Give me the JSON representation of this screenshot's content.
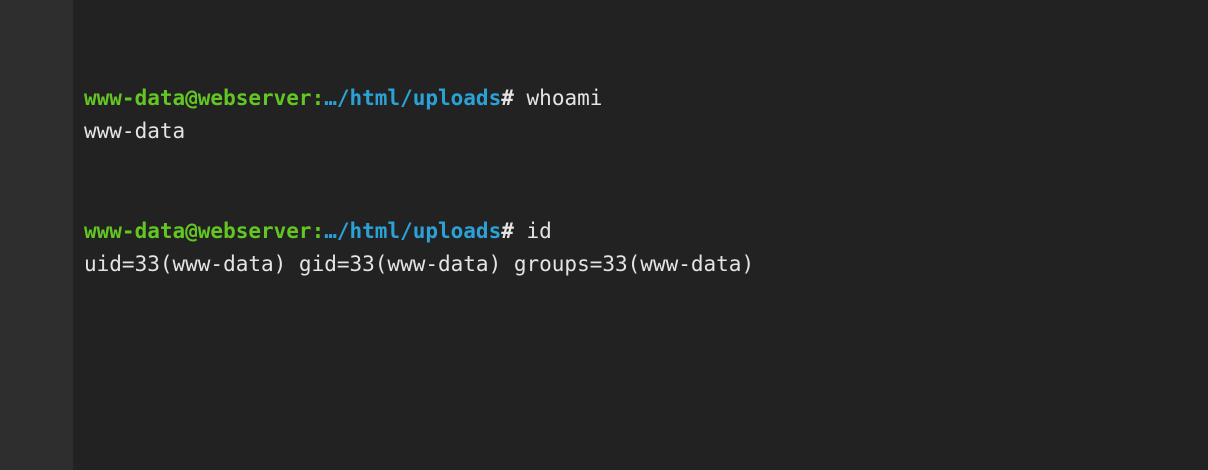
{
  "colors": {
    "background": "#222222",
    "gutter": "#2e2e2e",
    "user_host": "#63c623",
    "path": "#2aa2d8",
    "text": "#e4e4e4"
  },
  "terminal": {
    "entries": [
      {
        "prompt_user": "www-data@webserver:",
        "prompt_path": "…/html/uploads",
        "prompt_symbol": "#",
        "command": " whoami",
        "output": "www-data"
      },
      {
        "prompt_user": "www-data@webserver:",
        "prompt_path": "…/html/uploads",
        "prompt_symbol": "#",
        "command": " id",
        "output": "uid=33(www-data) gid=33(www-data) groups=33(www-data)"
      }
    ]
  }
}
